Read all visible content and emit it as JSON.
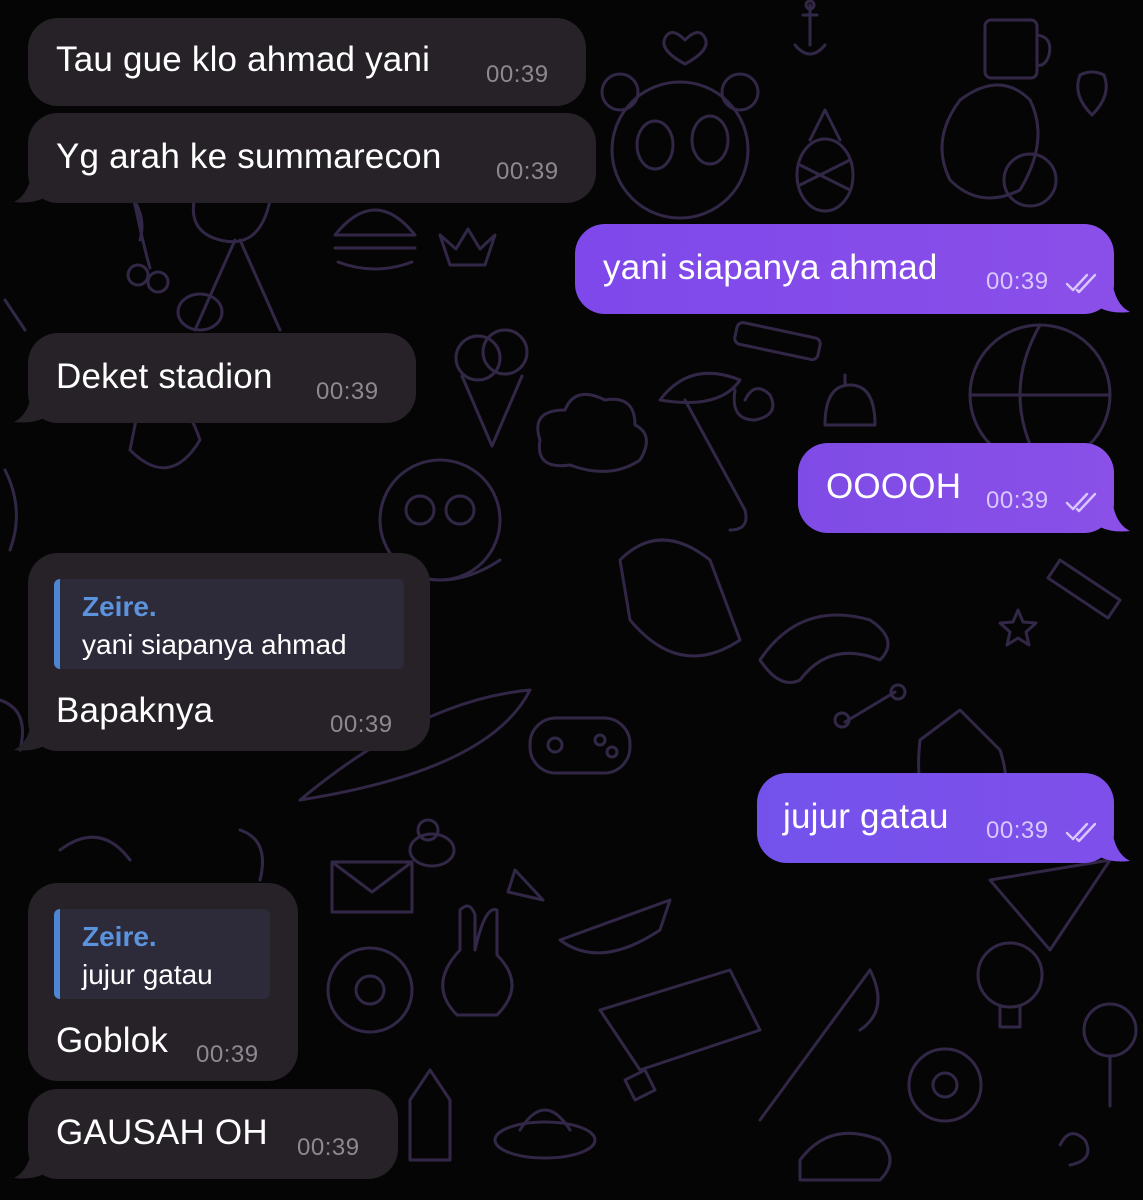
{
  "messages": [
    {
      "id": "m1",
      "direction": "incoming",
      "text": "Tau gue klo ahmad yani",
      "time": "00:39"
    },
    {
      "id": "m2",
      "direction": "incoming",
      "text": "Yg arah ke summarecon",
      "time": "00:39"
    },
    {
      "id": "m3",
      "direction": "outgoing",
      "text": "yani siapanya ahmad",
      "time": "00:39",
      "status_icon": "double-check-icon"
    },
    {
      "id": "m4",
      "direction": "incoming",
      "text": "Deket stadion",
      "time": "00:39"
    },
    {
      "id": "m5",
      "direction": "outgoing",
      "text": "OOOOH",
      "time": "00:39",
      "status_icon": "double-check-icon"
    },
    {
      "id": "m6",
      "direction": "incoming",
      "text": "Bapaknya",
      "time": "00:39",
      "reply": {
        "author": "Zeire.",
        "text": "yani siapanya ahmad"
      }
    },
    {
      "id": "m7",
      "direction": "outgoing",
      "text": "jujur gatau",
      "time": "00:39",
      "status_icon": "double-check-icon"
    },
    {
      "id": "m8",
      "direction": "incoming",
      "text": "Goblok",
      "time": "00:39",
      "reply": {
        "author": "Zeire.",
        "text": "jujur gatau"
      }
    },
    {
      "id": "m9",
      "direction": "incoming",
      "text": "GAUSAH OH",
      "time": "00:39"
    }
  ],
  "colors": {
    "background": "#050505",
    "incoming_bubble": "#262228",
    "outgoing_bubble": "#8a4fea",
    "reply_accent": "#5b93dc",
    "pattern_line": "#3b2d52"
  }
}
